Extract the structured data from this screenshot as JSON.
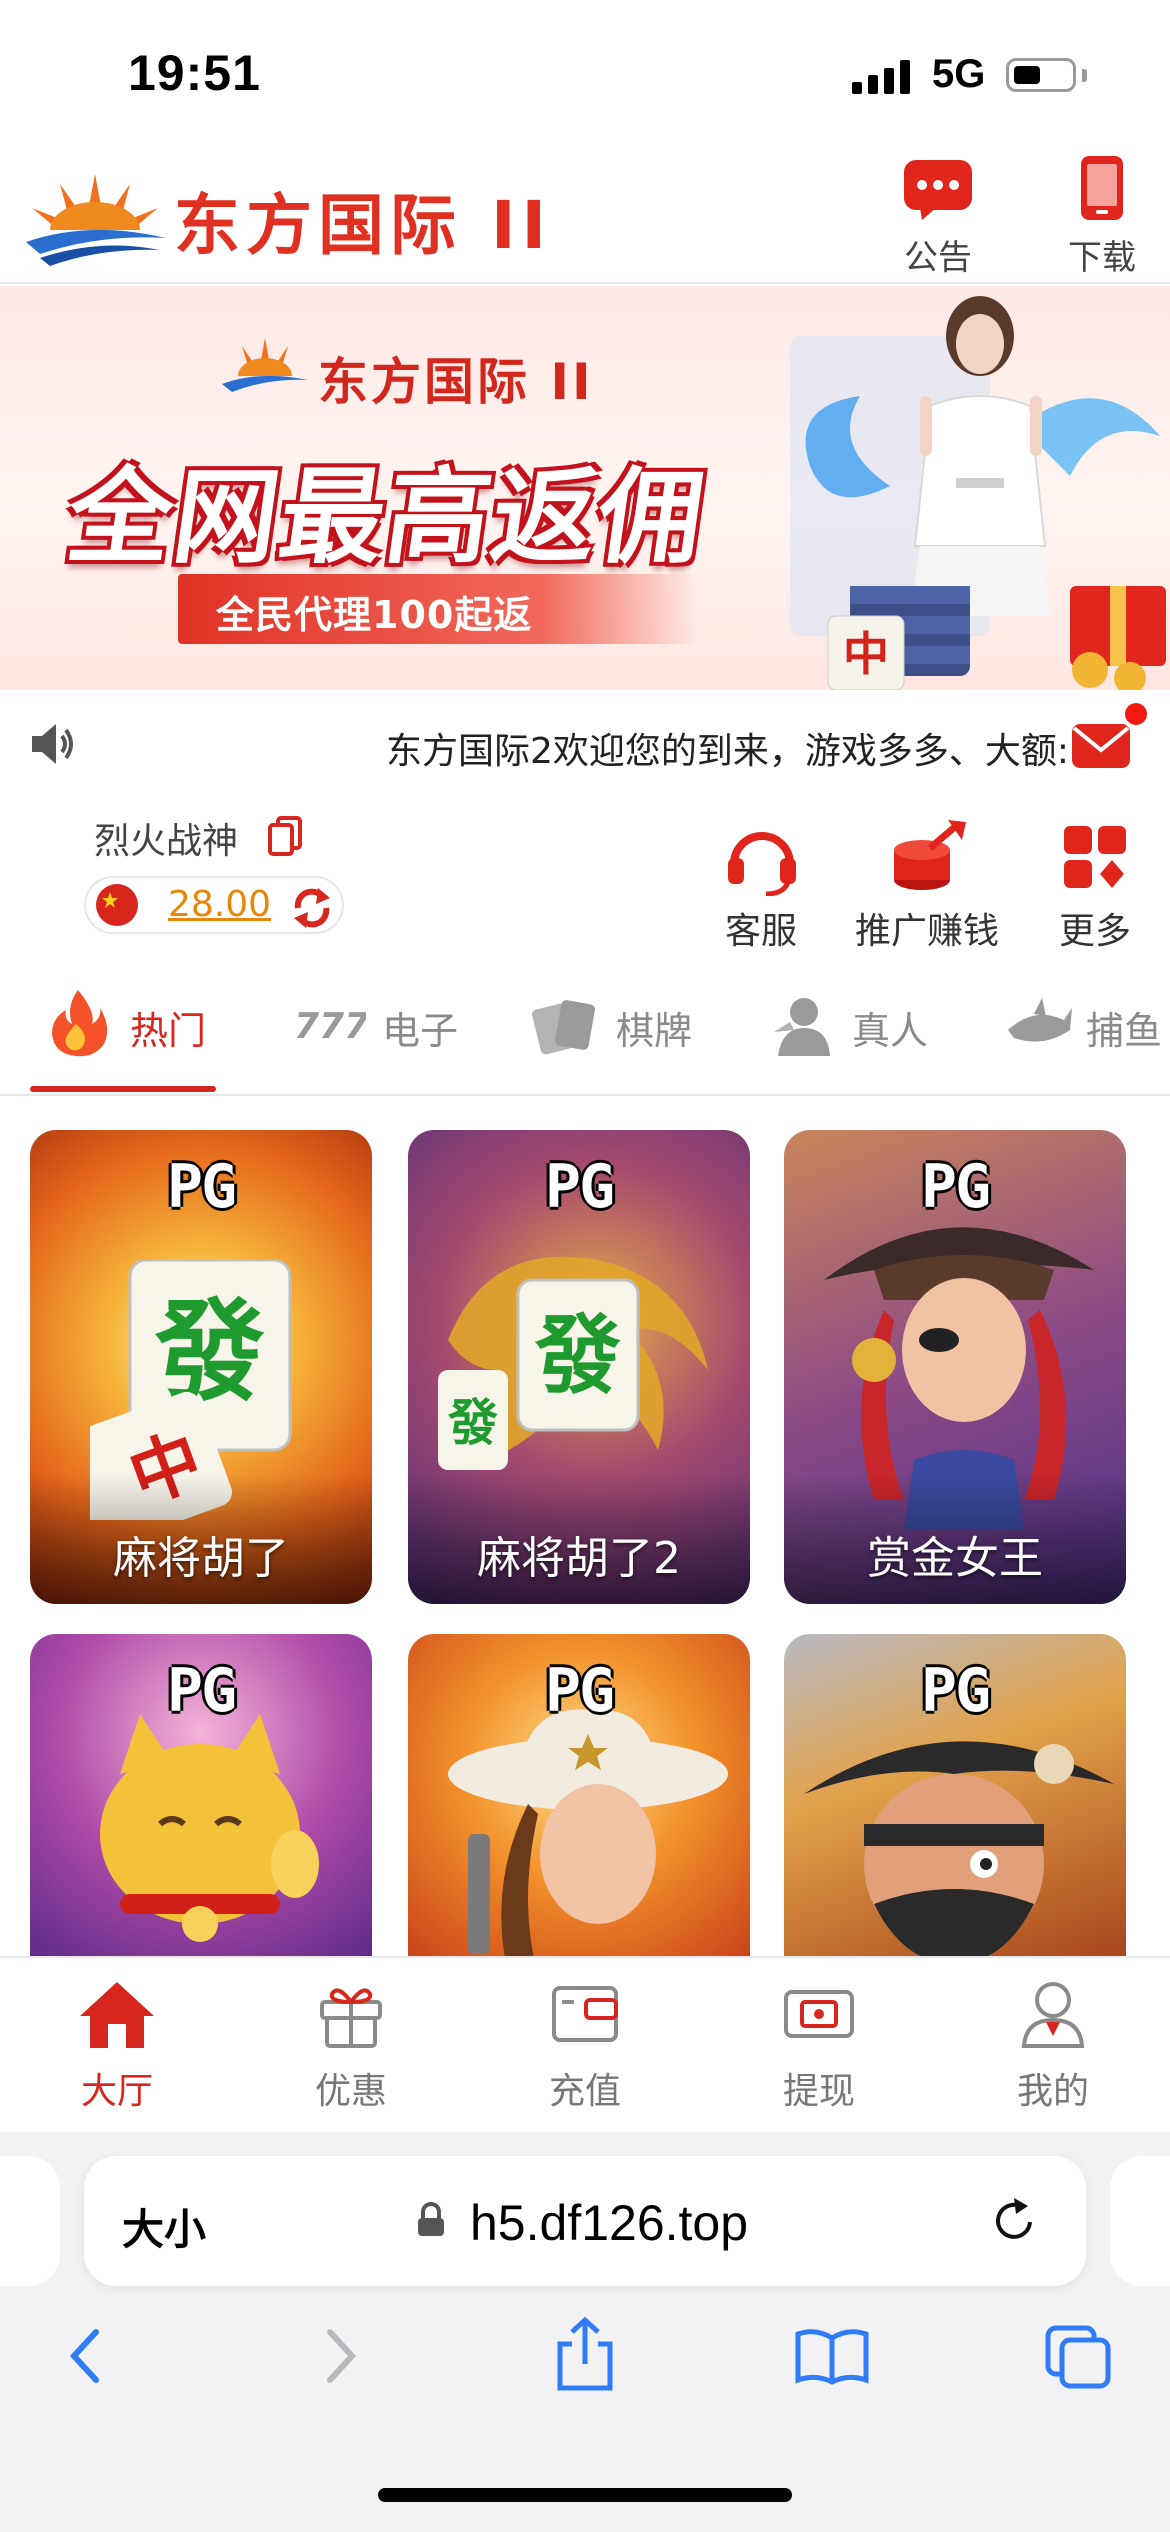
{
  "status_bar": {
    "time": "19:51",
    "network": "5G"
  },
  "header": {
    "brand": "东方国际 II",
    "notice_label": "公告",
    "download_label": "下载"
  },
  "banner": {
    "brand": "东方国际 II",
    "headline": "全网最高返佣",
    "subline": "全民代理100起返",
    "tile_char": "中"
  },
  "marquee": {
    "text": "东方国际2欢迎您的到来，游戏多多、大额:"
  },
  "user": {
    "name": "烈火战神",
    "balance": "28.00"
  },
  "quick_actions": [
    {
      "label": "客服",
      "icon": "headset-icon"
    },
    {
      "label": "推广赚钱",
      "icon": "chips-icon"
    },
    {
      "label": "更多",
      "icon": "grid-icon"
    }
  ],
  "categories": [
    {
      "label": "热门",
      "icon": "flame-icon",
      "active": true
    },
    {
      "label": "电子",
      "icon": "slot-777-icon"
    },
    {
      "label": "棋牌",
      "icon": "cards-icon"
    },
    {
      "label": "真人",
      "icon": "dealer-icon"
    },
    {
      "label": "捕鱼",
      "icon": "shark-icon"
    }
  ],
  "games": [
    {
      "provider": "PG",
      "name": "麻将胡了"
    },
    {
      "provider": "PG",
      "name": "麻将胡了2"
    },
    {
      "provider": "PG",
      "name": "赏金女王"
    },
    {
      "provider": "PG",
      "name": ""
    },
    {
      "provider": "PG",
      "name": ""
    },
    {
      "provider": "PG",
      "name": ""
    }
  ],
  "tabs": [
    {
      "label": "大厅",
      "icon": "home-icon",
      "active": true
    },
    {
      "label": "优惠",
      "icon": "gift-icon"
    },
    {
      "label": "充值",
      "icon": "wallet-icon"
    },
    {
      "label": "提现",
      "icon": "withdraw-icon"
    },
    {
      "label": "我的",
      "icon": "user-icon"
    }
  ],
  "browser": {
    "text_size": "大小",
    "url": "h5.df126.top"
  },
  "colors": {
    "brand_red": "#d7261d",
    "balance_orange": "#e8860a",
    "inactive_gray": "#8a8a8a"
  }
}
